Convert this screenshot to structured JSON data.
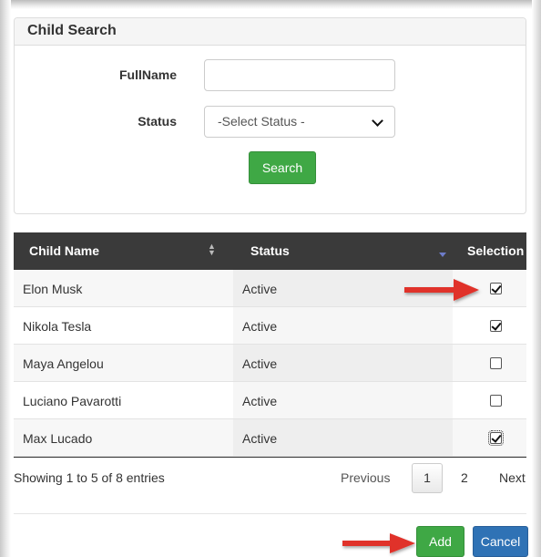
{
  "search_panel": {
    "title": "Child Search",
    "fullname_label": "FullName",
    "fullname_value": "",
    "fullname_placeholder": "",
    "status_label": "Status",
    "status_selected": "-Select Status -",
    "search_button": "Search"
  },
  "table": {
    "columns": [
      "Child Name",
      "Status",
      "Selection"
    ],
    "rows": [
      {
        "name": "Elon Musk",
        "status": "Active",
        "selected": true
      },
      {
        "name": "Nikola Tesla",
        "status": "Active",
        "selected": true
      },
      {
        "name": "Maya Angelou",
        "status": "Active",
        "selected": false
      },
      {
        "name": "Luciano Pavarotti",
        "status": "Active",
        "selected": false
      },
      {
        "name": "Max Lucado",
        "status": "Active",
        "selected": true
      }
    ]
  },
  "footer": {
    "info": "Showing 1 to 5 of 8 entries",
    "pager": {
      "previous": "Previous",
      "current": "1",
      "page2": "2",
      "next": "Next"
    },
    "add_button": "Add",
    "cancel_button": "Cancel"
  },
  "colors": {
    "header_dark": "#3a3a3a",
    "green": "#3fa845",
    "blue": "#2f72b5",
    "annotation_red": "#e0332b"
  },
  "icons": [
    "sort-icon",
    "sort-desc-icon",
    "chevron-down-icon",
    "checkbox-icon",
    "red-arrow-icon"
  ]
}
